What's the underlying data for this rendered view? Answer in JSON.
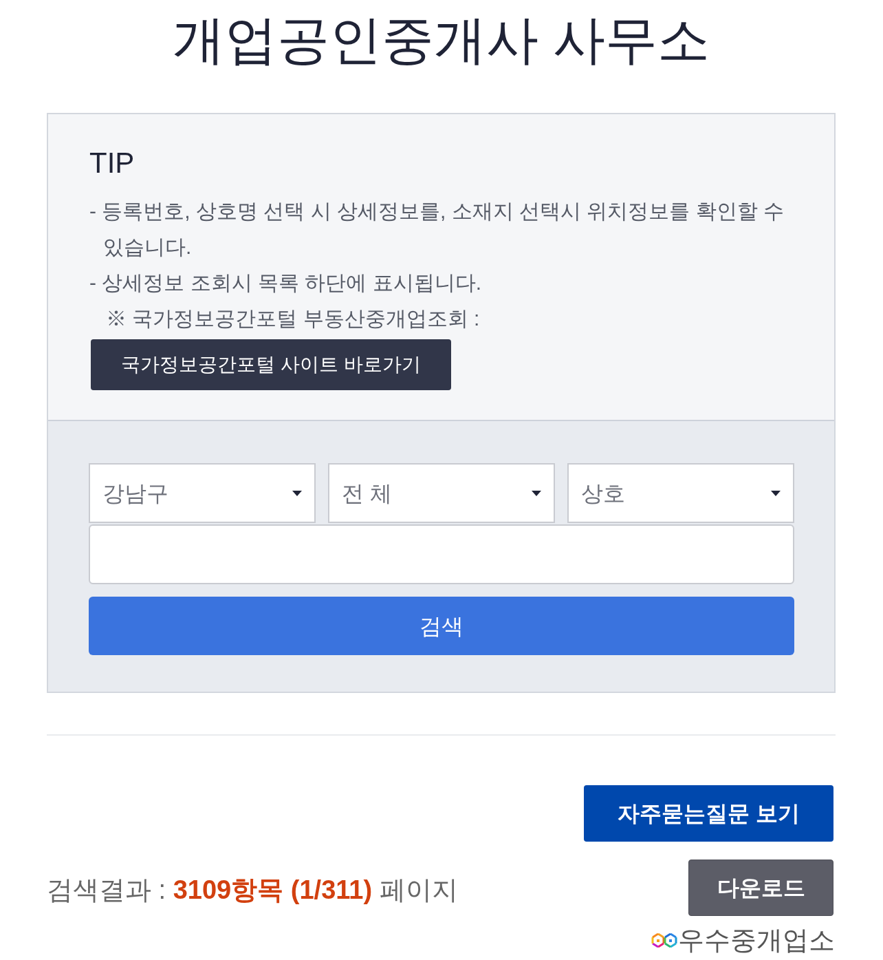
{
  "page_title": "개업공인중개사 사무소",
  "tip": {
    "title": "TIP",
    "items": [
      {
        "kind": "bullet",
        "text": "- 등록번호, 상호명 선택 시 상세정보를, 소재지 선택시 위치정보를 확인할 수 있습니다."
      },
      {
        "kind": "bullet",
        "text": "- 상세정보 조회시 목록 하단에 표시됩니다."
      },
      {
        "kind": "note",
        "text": "※ 국가정보공간포털 부동산중개업조회 :"
      }
    ],
    "link_button": "국가정보공간포털 사이트 바로가기"
  },
  "search": {
    "selects": [
      {
        "value": "강남구"
      },
      {
        "value": "전 체"
      },
      {
        "value": "상호"
      }
    ],
    "button": "검색"
  },
  "faq_button": "자주묻는질문 보기",
  "result_summary": "검색결과 : **3109항목 (1/311)** 페이지",
  "download_button": "다운로드",
  "badge": {
    "label": "우수중개업소"
  }
}
